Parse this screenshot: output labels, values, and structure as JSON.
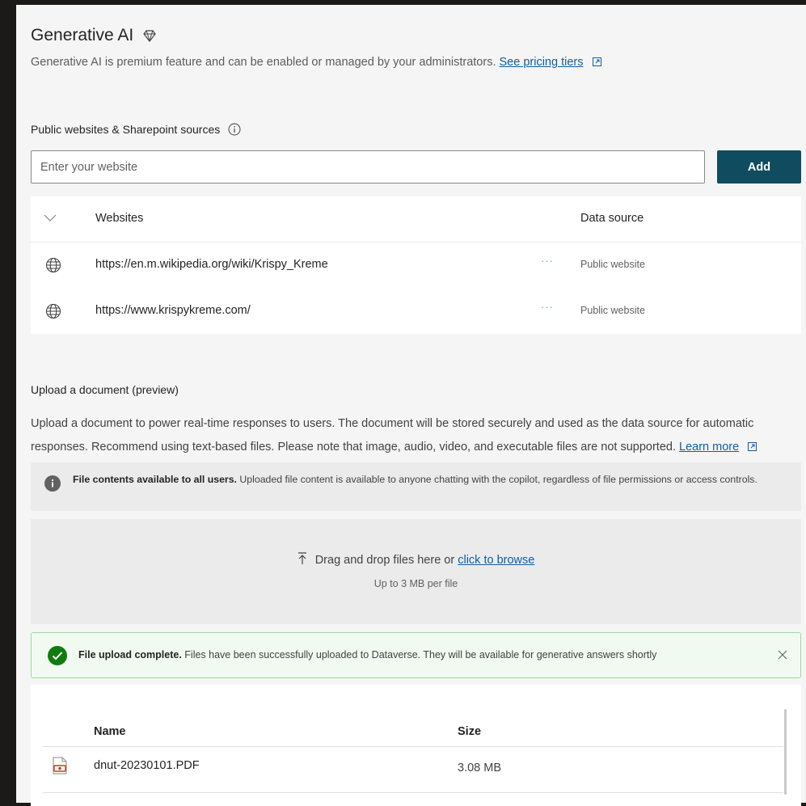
{
  "header": {
    "title": "Generative AI",
    "title_icon": "diamond-premium-icon",
    "description": "Generative AI is premium feature and can be enabled or managed by your administrators.",
    "pricing_link": "See pricing tiers"
  },
  "websites": {
    "section_label": "Public websites & Sharepoint sources",
    "input_placeholder": "Enter your website",
    "add_label": "Add",
    "columns": {
      "websites": "Websites",
      "data_source": "Data source"
    },
    "rows": [
      {
        "url": "https://en.m.wikipedia.org/wiki/Krispy_Kreme",
        "more": "···",
        "source": "Public website"
      },
      {
        "url": "https://www.krispykreme.com/",
        "more": "···",
        "source": "Public website"
      }
    ]
  },
  "upload": {
    "section_label": "Upload a document (preview)",
    "description": "Upload a document to power real-time responses to users. The document will be stored securely and used as the data source for automatic responses. Recommend using text-based files. Please note that image, audio, video, and executable files are not supported.",
    "learn_more": "Learn more",
    "info_bold": "File contents available to all users.",
    "info_text": "Uploaded file content is available to anyone chatting with the copilot, regardless of file permissions or access controls.",
    "drop_text": "Drag and drop files here or",
    "browse_link": "click to browse",
    "limit_text": "Up to 3 MB per file",
    "success_bold": "File upload complete.",
    "success_text": "Files have been successfully uploaded to Dataverse. They will be available for generative answers shortly",
    "files_columns": {
      "name": "Name",
      "size": "Size"
    },
    "files": [
      {
        "name": "dnut-20230101.PDF",
        "size": "3.08 MB"
      }
    ]
  },
  "colors": {
    "accent_button": "#0f4c5f",
    "link": "#115ea3",
    "success_green": "#107c10",
    "panel_bg": "#f5f5f5"
  }
}
